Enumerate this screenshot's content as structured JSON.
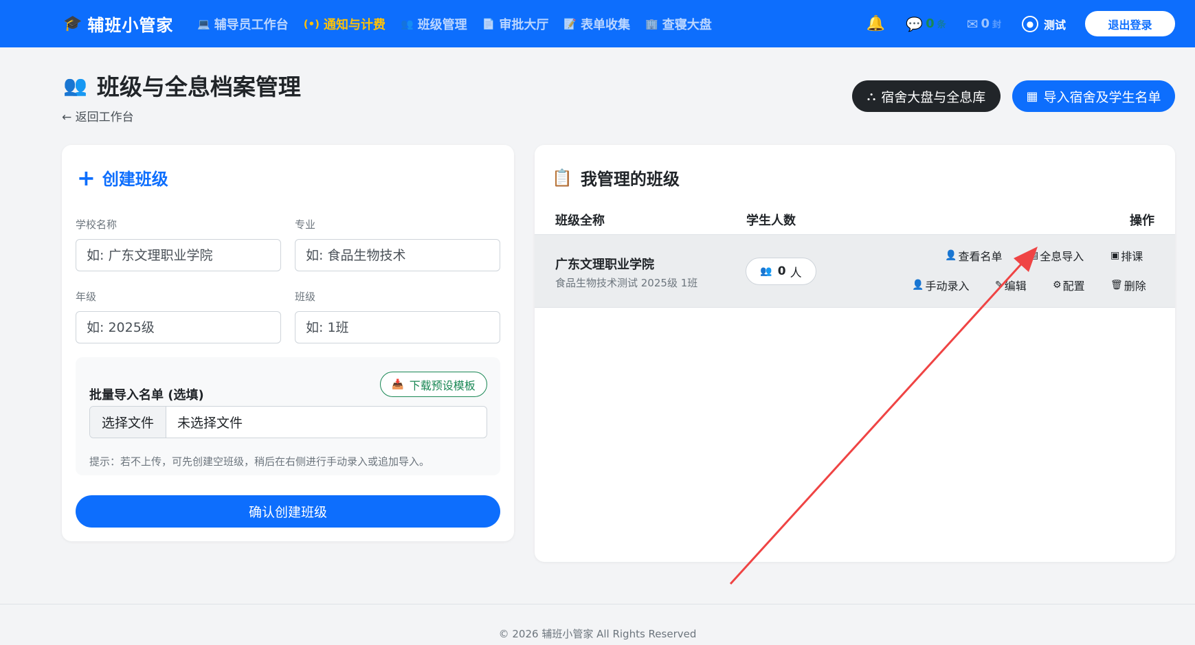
{
  "app": {
    "brand": "辅班小管家"
  },
  "nav": [
    {
      "label": "辅导员工作台",
      "icon": "laptop-icon",
      "glyph": "💻",
      "active": false
    },
    {
      "label": "通知与计费",
      "icon": "broadcast-icon",
      "glyph": "(•)",
      "active": true
    },
    {
      "label": "班级管理",
      "icon": "people-icon",
      "glyph": "👥",
      "active": false
    },
    {
      "label": "审批大厅",
      "icon": "document-icon",
      "glyph": "📄",
      "active": false
    },
    {
      "label": "表单收集",
      "icon": "form-icon",
      "glyph": "📝",
      "active": false
    },
    {
      "label": "查寝大盘",
      "icon": "building-icon",
      "glyph": "🏢",
      "active": false
    }
  ],
  "topright": {
    "msg_count": "0",
    "msg_unit": "条",
    "mail_count": "0",
    "mail_unit": "封",
    "user": "测试",
    "logout": "退出登录"
  },
  "page": {
    "title": "班级与全息档案管理",
    "back": "← 返回工作台",
    "btn_dorm_board": "宿舍大盘与全息库",
    "btn_import": "导入宿舍及学生名单"
  },
  "create": {
    "title": "创建班级",
    "school_label": "学校名称",
    "school_placeholder": "如: 广东文理职业学院",
    "major_label": "专业",
    "major_placeholder": "如: 食品生物技术",
    "grade_label": "年级",
    "grade_placeholder": "如: 2025级",
    "class_label": "班级",
    "class_placeholder": "如: 1班",
    "import_title": "批量导入名单 (选填)",
    "download_template": "下载预设模板",
    "choose_file": "选择文件",
    "no_file": "未选择文件",
    "hint": "提示：若不上传，可先创建空班级，稍后在右侧进行手动录入或追加导入。",
    "submit": "确认创建班级"
  },
  "classes": {
    "title": "我管理的班级",
    "headers": {
      "name": "班级全称",
      "count": "学生人数",
      "actions": "操作"
    },
    "rows": [
      {
        "school": "广东文理职业学院",
        "sub": "食品生物技术测试 2025级 1班",
        "count": "0",
        "count_unit": "人",
        "actions": {
          "view": "查看名单",
          "import": "全息导入",
          "schedule": "排课",
          "manual": "手动录入",
          "edit": "编辑",
          "config": "配置",
          "delete": "删除"
        }
      }
    ]
  },
  "footer": "© 2026 辅班小管家 All Rights Reserved",
  "colors": {
    "primary": "#0d6efd",
    "dark": "#212529",
    "warning": "#ffc107",
    "success": "#198754",
    "annotation": "#ef4444"
  }
}
